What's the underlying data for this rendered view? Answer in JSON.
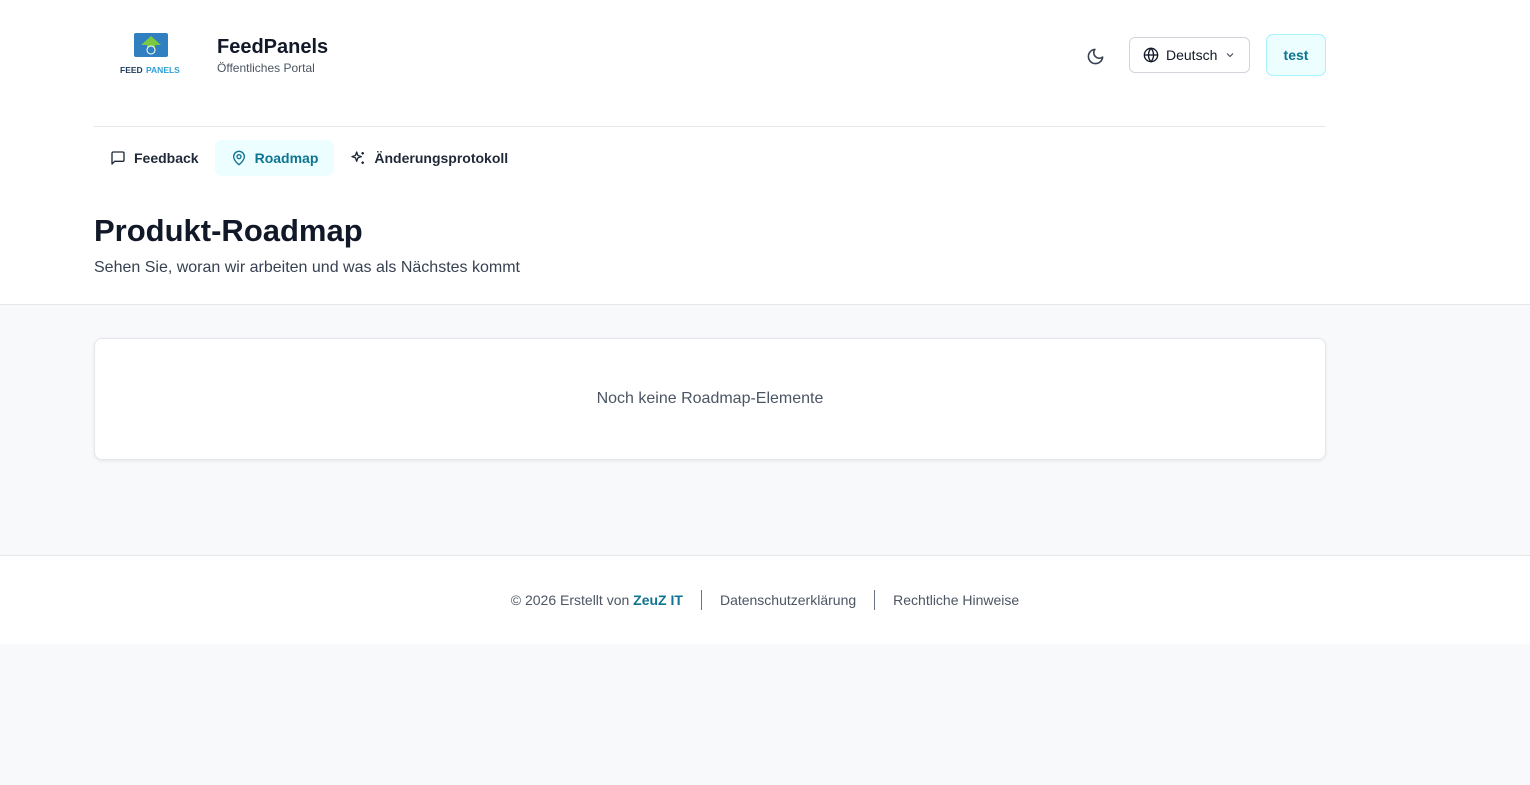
{
  "header": {
    "logo_text_feed": "FEED",
    "logo_text_panels": "PANELS",
    "brand_name": "FeedPanels",
    "brand_subtitle": "Öffentliches Portal",
    "language": "Deutsch",
    "user_label": "test"
  },
  "nav": {
    "items": [
      {
        "label": "Feedback",
        "icon": "message-square-icon"
      },
      {
        "label": "Roadmap",
        "icon": "map-pin-icon",
        "active": true
      },
      {
        "label": "Änderungsprotokoll",
        "icon": "sparkles-icon"
      }
    ]
  },
  "page": {
    "title": "Produkt-Roadmap",
    "subtitle": "Sehen Sie, woran wir arbeiten und was als Nächstes kommt"
  },
  "empty_state": {
    "message": "Noch keine Roadmap-Elemente"
  },
  "footer": {
    "copyright": "© 2026 Erstellt von",
    "company": "ZeuZ IT",
    "privacy": "Datenschutzerklärung",
    "legal": "Rechtliche Hinweise"
  },
  "colors": {
    "accent": "#0e7490",
    "accent_bg": "#ecfeff",
    "logo_blue": "#2f7fc1",
    "logo_green": "#5cb85c"
  }
}
